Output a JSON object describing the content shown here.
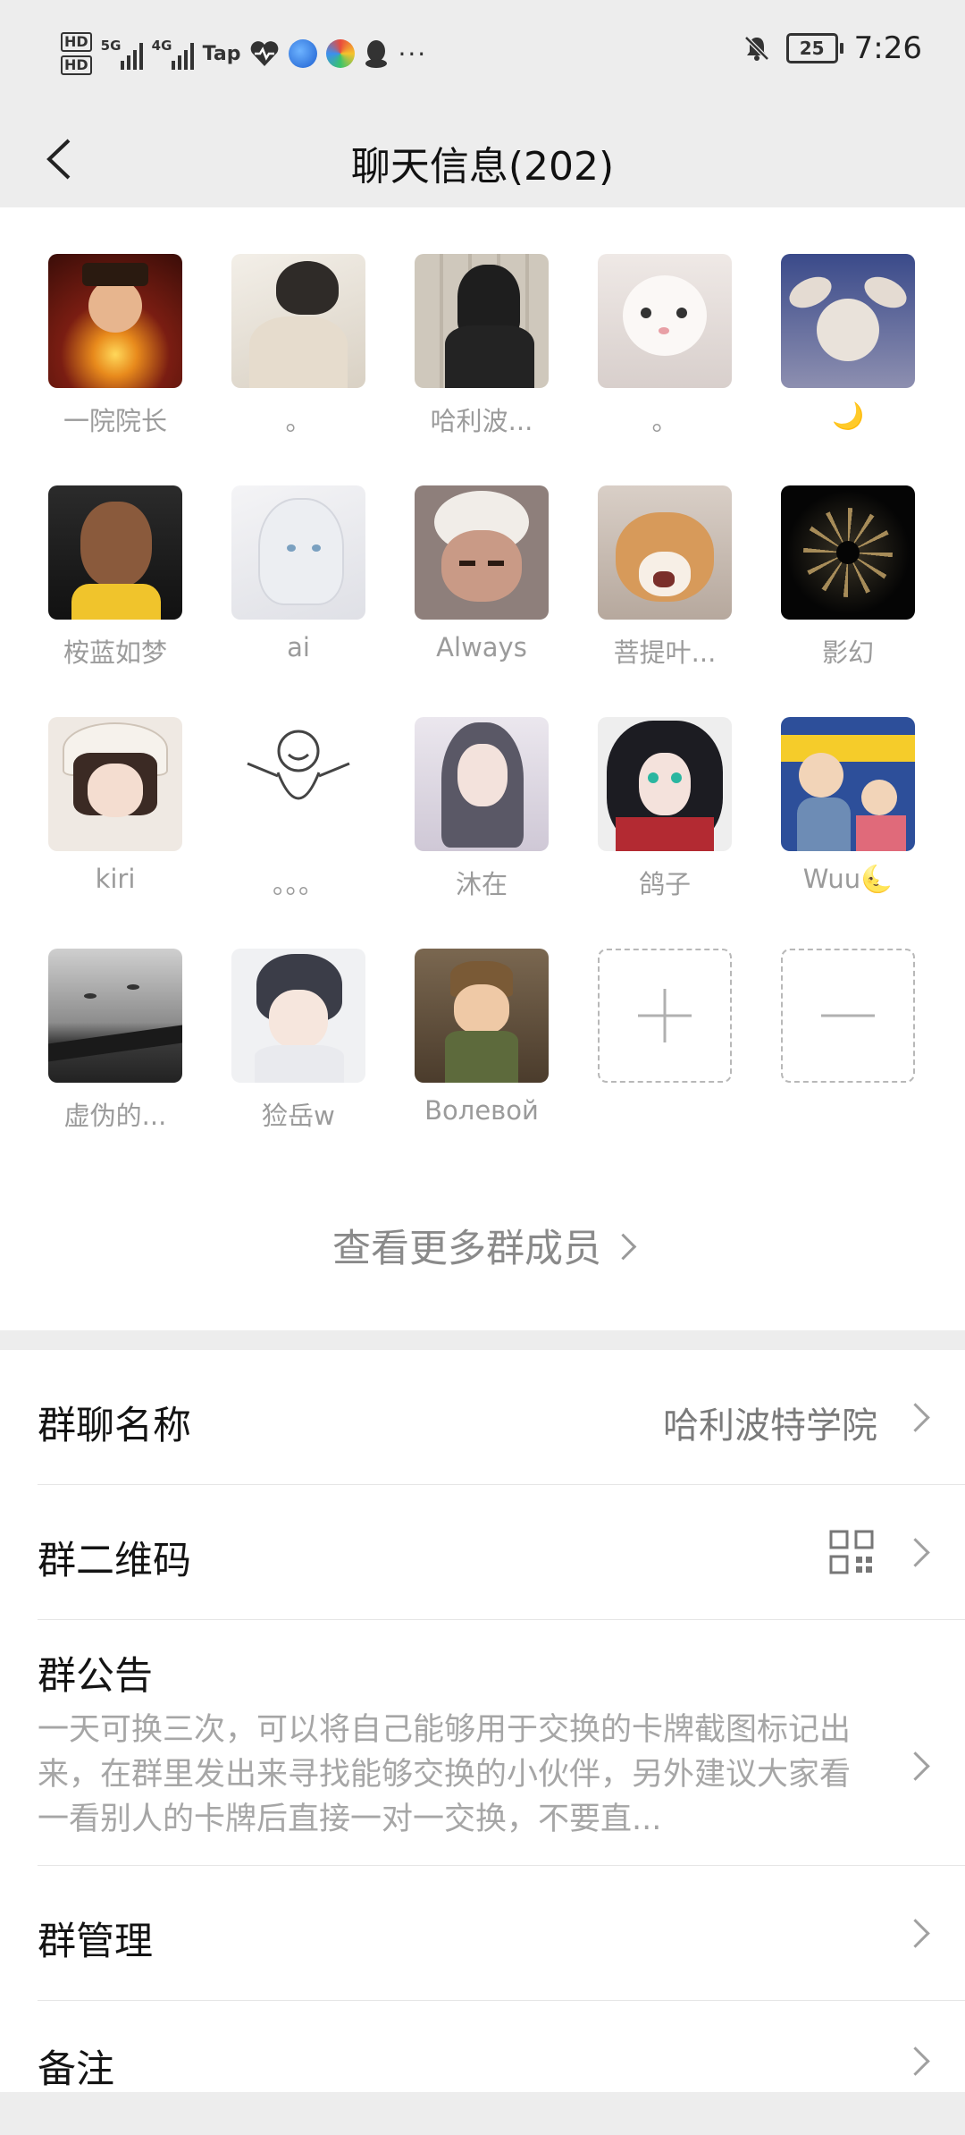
{
  "status_bar": {
    "hd1": "HD",
    "hd2": "HD",
    "net1": "5G",
    "net2": "4G",
    "tap": "Tap",
    "dots": "···",
    "battery": "25",
    "time": "7:26"
  },
  "nav": {
    "title": "聊天信息(202)",
    "back_icon": "chevron-left-icon"
  },
  "members": [
    {
      "name": "一院院长",
      "avatar": "avatar-deity"
    },
    {
      "name": "。",
      "avatar": "avatar-hug-illustration"
    },
    {
      "name": "哈利波...",
      "avatar": "avatar-hooded-figure"
    },
    {
      "name": "。",
      "avatar": "avatar-white-kitten"
    },
    {
      "name": "🌙",
      "avatar": "avatar-cat-ears"
    },
    {
      "name": "桉蓝如梦",
      "avatar": "avatar-basketball-player"
    },
    {
      "name": "ai",
      "avatar": "avatar-anime-white-hair"
    },
    {
      "name": "Always",
      "avatar": "avatar-cartoon-sheep"
    },
    {
      "name": "菩提叶...",
      "avatar": "avatar-shiba-dog"
    },
    {
      "name": "影幻",
      "avatar": "avatar-dark-pattern"
    },
    {
      "name": "kiri",
      "avatar": "avatar-girl-hat"
    },
    {
      "name": "。。。",
      "avatar": "avatar-doodle"
    },
    {
      "name": "沐在",
      "avatar": "avatar-anime-girl"
    },
    {
      "name": "鸽子",
      "avatar": "avatar-anime-dark-hair"
    },
    {
      "name": "Wuu🌜",
      "avatar": "avatar-cartoon-shopping"
    },
    {
      "name": "虚伪的...",
      "avatar": "avatar-seagulls"
    },
    {
      "name": "猃岳w",
      "avatar": "avatar-anime-boy"
    },
    {
      "name": "Волевой",
      "avatar": "avatar-cartoon-room"
    }
  ],
  "add_member_icon": "plus-icon",
  "remove_member_icon": "minus-icon",
  "more_members": "查看更多群成员",
  "settings": {
    "group_name_label": "群聊名称",
    "group_name_value": "哈利波特学院",
    "qr_label": "群二维码",
    "qr_icon": "qr-code-icon",
    "notice_label": "群公告",
    "notice_text": "一天可换三次，可以将自己能够用于交换的卡牌截图标记出来，在群里发出来寻找能够交换的小伙伴，另外建议大家看一看别人的卡牌后直接一对一交换，不要直...",
    "manage_label": "群管理",
    "remark_label": "备注"
  },
  "colors": {
    "background": "#ededed",
    "card": "#ffffff",
    "secondary_text": "#9b9b9b"
  }
}
